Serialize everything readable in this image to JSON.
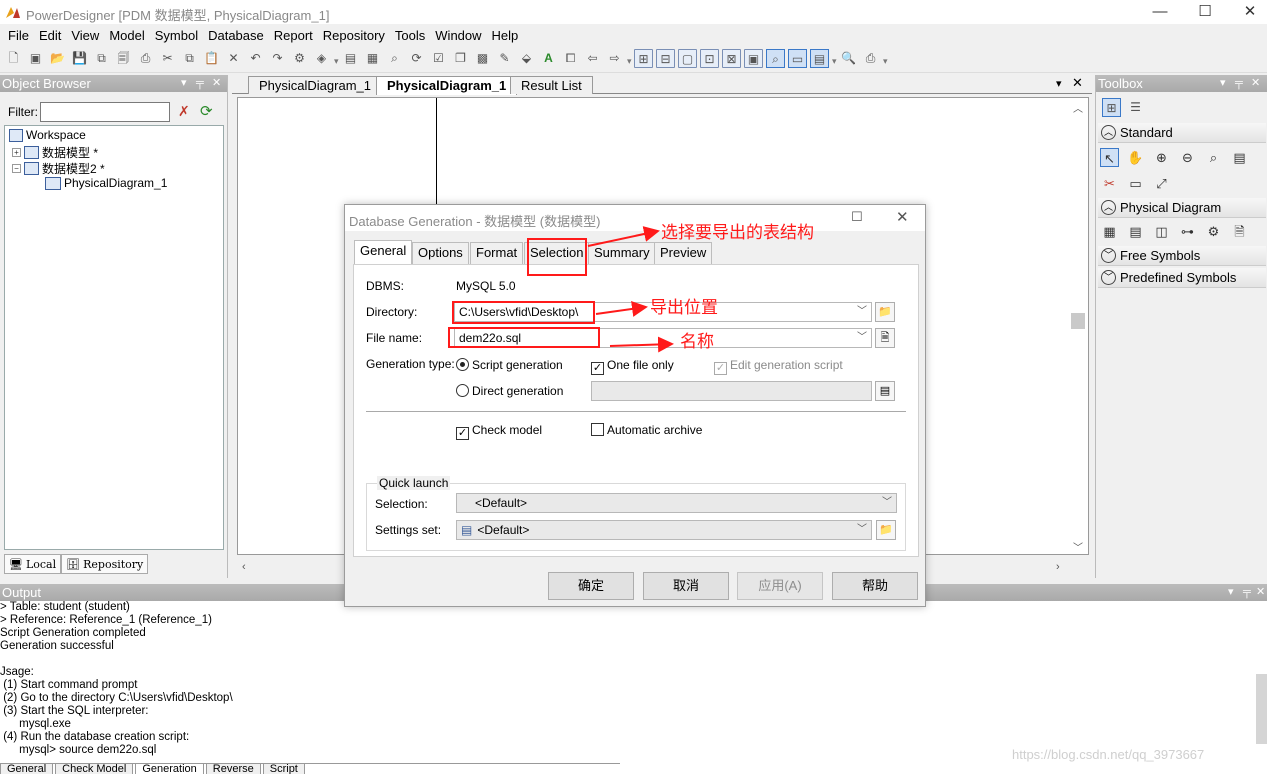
{
  "window": {
    "title": "PowerDesigner [PDM 数据模型, PhysicalDiagram_1]"
  },
  "menu": [
    "File",
    "Edit",
    "View",
    "Model",
    "Symbol",
    "Database",
    "Report",
    "Repository",
    "Tools",
    "Window",
    "Help"
  ],
  "object_browser": {
    "title": "Object Browser",
    "filter_label": "Filter:",
    "filter_value": "",
    "tree": [
      "Workspace",
      "数据模型 *",
      "数据模型2 *",
      "PhysicalDiagram_1"
    ],
    "bottom_tabs": [
      "Local",
      "Repository"
    ]
  },
  "editor": {
    "tabs": [
      "PhysicalDiagram_1",
      "PhysicalDiagram_1",
      "Result List"
    ],
    "active_tab": 1
  },
  "toolbox": {
    "title": "Toolbox",
    "sections": [
      "Standard",
      "Physical Diagram",
      "Free Symbols",
      "Predefined Symbols"
    ]
  },
  "output": {
    "title": "Output",
    "lines": [
      "> Table: student (student)",
      "> Reference: Reference_1 (Reference_1)",
      "Script Generation completed",
      "Generation successful",
      "",
      "Jsage:",
      " (1) Start command prompt",
      " (2) Go to the directory C:\\Users\\vfid\\Desktop\\",
      " (3) Start the SQL interpreter:",
      "      mysql.exe",
      " (4) Run the database creation script:",
      "      mysql> source dem22o.sql"
    ],
    "tabs": [
      "General",
      "Check Model",
      "Generation",
      "Reverse",
      "Script"
    ]
  },
  "dialog": {
    "title": "Database Generation - 数据模型 (数据模型)",
    "tabs": [
      "General",
      "Options",
      "Format",
      "Selection",
      "Summary",
      "Preview"
    ],
    "dbms_label": "DBMS:",
    "dbms_value": "MySQL 5.0",
    "directory_label": "Directory:",
    "directory_value": "C:\\Users\\vfid\\Desktop\\",
    "filename_label": "File name:",
    "filename_value": "dem22o.sql",
    "gentype_label": "Generation type:",
    "script_generation": "Script generation",
    "direct_generation": "Direct generation",
    "one_file_only": "One file only",
    "edit_generation_script": "Edit generation script",
    "check_model": "Check model",
    "automatic_archive": "Automatic archive",
    "quick_launch": "Quick launch",
    "selection_label": "Selection:",
    "selection_value": "<Default>",
    "settings_label": "Settings set:",
    "settings_value": "<Default>",
    "buttons": {
      "ok": "确定",
      "cancel": "取消",
      "apply": "应用(A)",
      "help": "帮助"
    }
  },
  "annotations": {
    "selection_note": "选择要导出的表结构",
    "directory_note": "导出位置",
    "filename_note": "名称"
  },
  "watermark": "https://blog.csdn.net/qq_3973667"
}
